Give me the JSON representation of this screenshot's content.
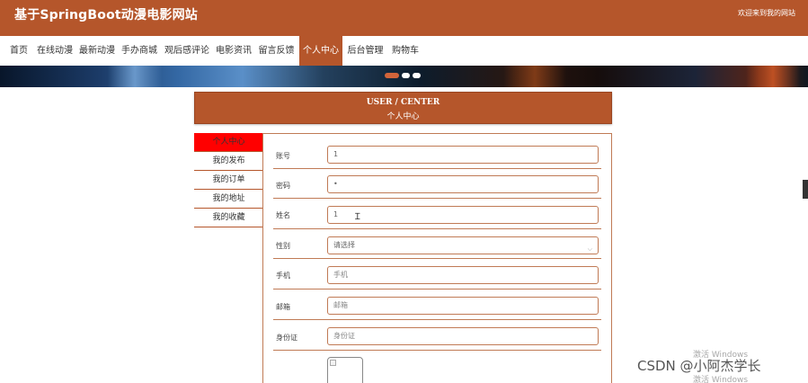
{
  "header": {
    "site_title": "基于SpringBoot动漫电影网站",
    "welcome": "欢迎来到我的网站"
  },
  "nav": {
    "items": [
      {
        "label": "首页",
        "active": false
      },
      {
        "label": "在线动漫",
        "active": false
      },
      {
        "label": "最新动漫",
        "active": false
      },
      {
        "label": "手办商城",
        "active": false
      },
      {
        "label": "观后感评论",
        "active": false
      },
      {
        "label": "电影资讯",
        "active": false
      },
      {
        "label": "留言反馈",
        "active": false
      },
      {
        "label": "个人中心",
        "active": true
      },
      {
        "label": "后台管理",
        "active": false
      },
      {
        "label": "购物车",
        "active": false
      }
    ]
  },
  "carousel": {
    "slide_count": 3,
    "active_index": 0
  },
  "user_center": {
    "title_en": "USER / CENTER",
    "title_cn": "个人中心"
  },
  "side_menu": {
    "items": [
      {
        "label": "个人中心",
        "active": true
      },
      {
        "label": "我的发布",
        "active": false
      },
      {
        "label": "我的订单",
        "active": false
      },
      {
        "label": "我的地址",
        "active": false
      },
      {
        "label": "我的收藏",
        "active": false
      }
    ]
  },
  "form": {
    "account": {
      "label": "账号",
      "value": "1"
    },
    "password": {
      "label": "密码",
      "value": "•"
    },
    "name": {
      "label": "姓名",
      "value": "1"
    },
    "gender": {
      "label": "性别",
      "value": "请选择"
    },
    "phone": {
      "label": "手机",
      "placeholder": "手机"
    },
    "email": {
      "label": "邮箱",
      "placeholder": "邮箱"
    },
    "id_card": {
      "label": "身份证",
      "placeholder": "身份证"
    }
  },
  "overlay": {
    "activate_windows": "激活 Windows",
    "watermark": "CSDN @小阿杰学长"
  },
  "colors": {
    "brand": "#b5562b",
    "active_menu": "#ff0000",
    "carousel_active_dot": "#d2643a",
    "carousel_dot": "#ffffff"
  }
}
